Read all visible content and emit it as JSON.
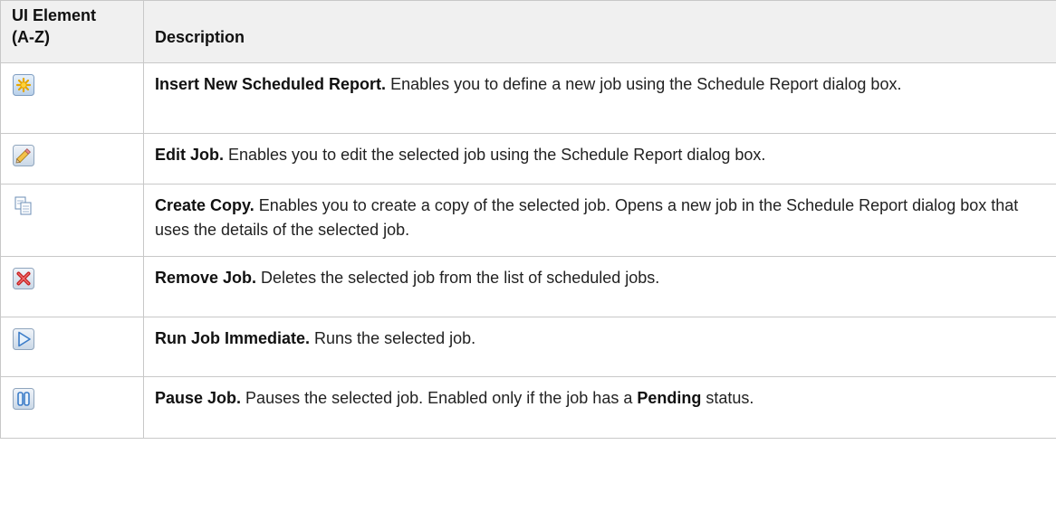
{
  "header": {
    "col1_line1": "UI Element",
    "col1_line2": "(A-Z)",
    "col2": "Description"
  },
  "rows": [
    {
      "icon": "insert-new-scheduled-report-icon",
      "title": "Insert New Scheduled Report.",
      "text": " Enables you to define a new job using the Schedule Report dialog box."
    },
    {
      "icon": "edit-job-icon",
      "title": "Edit Job.",
      "text": " Enables you to edit the selected job using the Schedule Report dialog box."
    },
    {
      "icon": "create-copy-icon",
      "title": "Create Copy.",
      "text": " Enables you to create a copy of the selected job. Opens a new job in the Schedule Report dialog box that uses the details of the selected job."
    },
    {
      "icon": "remove-job-icon",
      "title": "Remove Job.",
      "text": " Deletes the selected job from the list of scheduled jobs."
    },
    {
      "icon": "run-job-immediate-icon",
      "title": "Run Job Immediate.",
      "text": " Runs the selected job."
    },
    {
      "icon": "pause-job-icon",
      "title": "Pause Job.",
      "text_before": " Pauses the selected job. Enabled only if the job has a ",
      "bold_mid": "Pending",
      "text_after": " status."
    }
  ]
}
